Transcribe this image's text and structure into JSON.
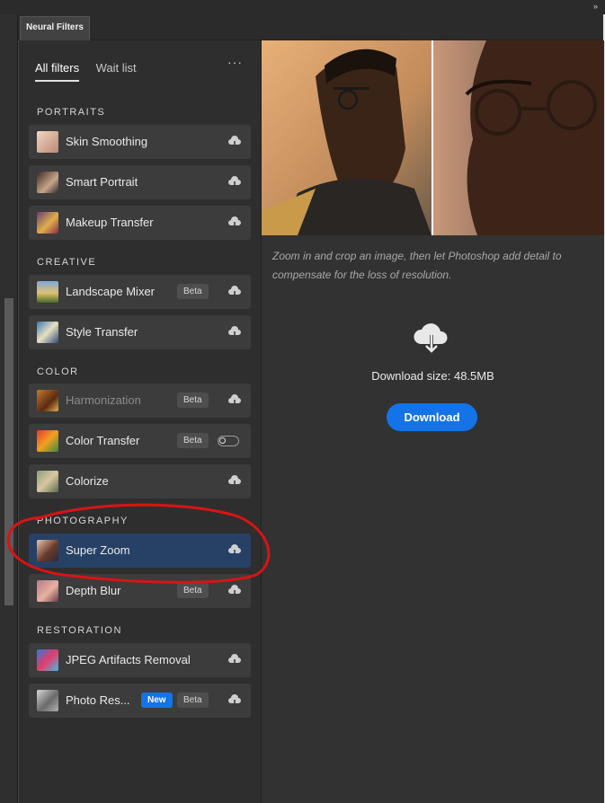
{
  "window": {
    "collapse_glyph": "»",
    "tab_title": "Neural Filters"
  },
  "filter_tabs": [
    {
      "label": "All filters",
      "active": true
    },
    {
      "label": "Wait list",
      "active": false
    }
  ],
  "more_glyph": "···",
  "sections": {
    "portraits": "PORTRAITS",
    "creative": "CREATIVE",
    "color": "COLOR",
    "photography": "PHOTOGRAPHY",
    "restoration": "RESTORATION"
  },
  "filters": {
    "skin_smoothing": {
      "label": "Skin Smoothing"
    },
    "smart_portrait": {
      "label": "Smart Portrait"
    },
    "makeup_transfer": {
      "label": "Makeup Transfer"
    },
    "landscape_mixer": {
      "label": "Landscape Mixer",
      "badge": "Beta"
    },
    "style_transfer": {
      "label": "Style Transfer"
    },
    "harmonization": {
      "label": "Harmonization",
      "badge": "Beta"
    },
    "color_transfer": {
      "label": "Color Transfer",
      "badge": "Beta"
    },
    "colorize": {
      "label": "Colorize"
    },
    "super_zoom": {
      "label": "Super Zoom"
    },
    "depth_blur": {
      "label": "Depth Blur",
      "badge": "Beta"
    },
    "jpeg_artifacts_removal": {
      "label": "JPEG Artifacts Removal"
    },
    "photo_restoration": {
      "label": "Photo Res...",
      "badge_new": "New",
      "badge": "Beta"
    }
  },
  "detail": {
    "description": "Zoom in and crop an image, then let Photoshop add detail to compensate for the loss of resolution.",
    "download_size": "Download size: 48.5MB",
    "download_label": "Download"
  },
  "colors": {
    "panel_bg": "#323232",
    "item_bg": "#3c3c3c",
    "selected_bg": "#274166",
    "accent": "#1473e6",
    "annotation": "#d81414"
  }
}
